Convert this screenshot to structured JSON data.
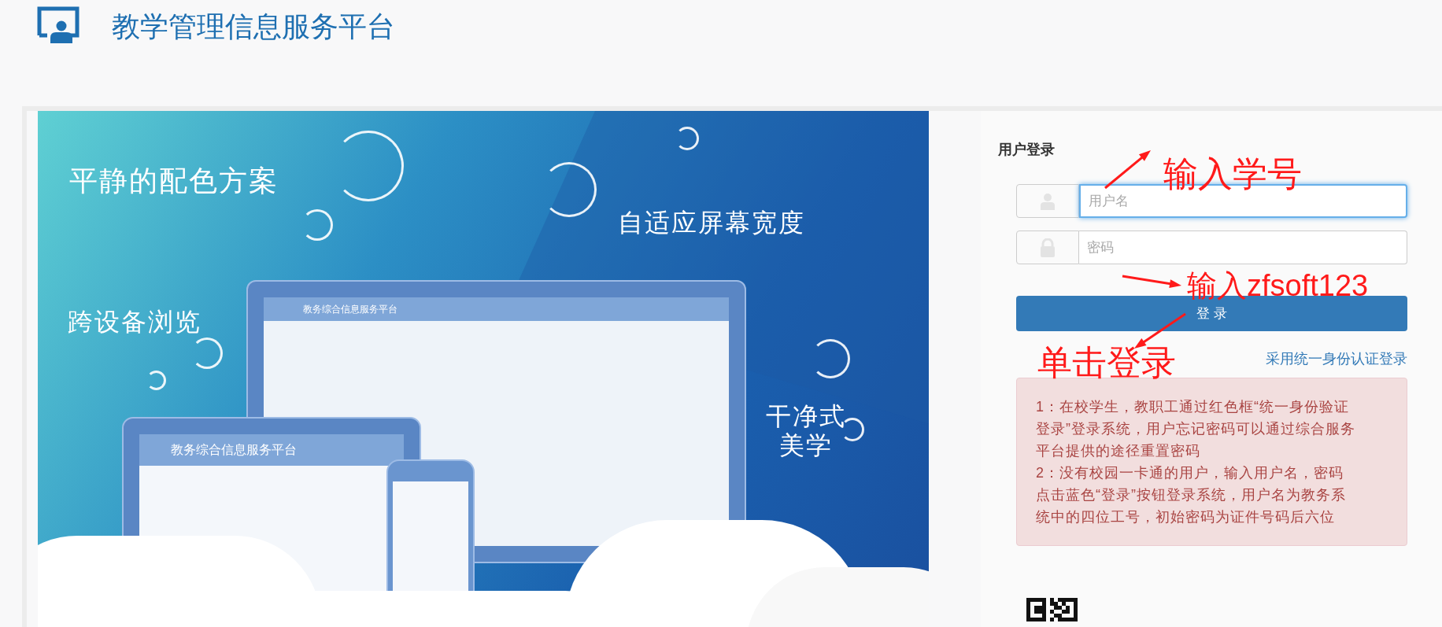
{
  "header": {
    "title": "教学管理信息服务平台"
  },
  "banner": {
    "captions": [
      "平静的配色方案",
      "自适应屏幕宽度",
      "跨设备浏览",
      "干净式美学"
    ],
    "device_titles": [
      "教务综合信息服务平台",
      "教务综合信息服务平台"
    ]
  },
  "login": {
    "title": "用户登录",
    "fields": [
      {
        "kind": "user",
        "placeholder": "用户名",
        "focused": true
      },
      {
        "kind": "lock",
        "placeholder": "密码",
        "focused": false
      }
    ],
    "button": "登 录",
    "link": "采用统一身份认证登录",
    "notice": [
      "1：在校学生，教职工通过红色框“统一身份验证登录”登录系统，用户忘记密码可以通过综合服务平台提供的途径重置密码",
      "2：没有校园一卡通的用户，输入用户名，密码点击蓝色“登录”按钮登录系统，用户名为教务系统中的四位工号，初始密码为证件号码后六位"
    ]
  },
  "annotations": [
    "输入学号",
    "输入zfsoft123",
    "单击登录"
  ]
}
